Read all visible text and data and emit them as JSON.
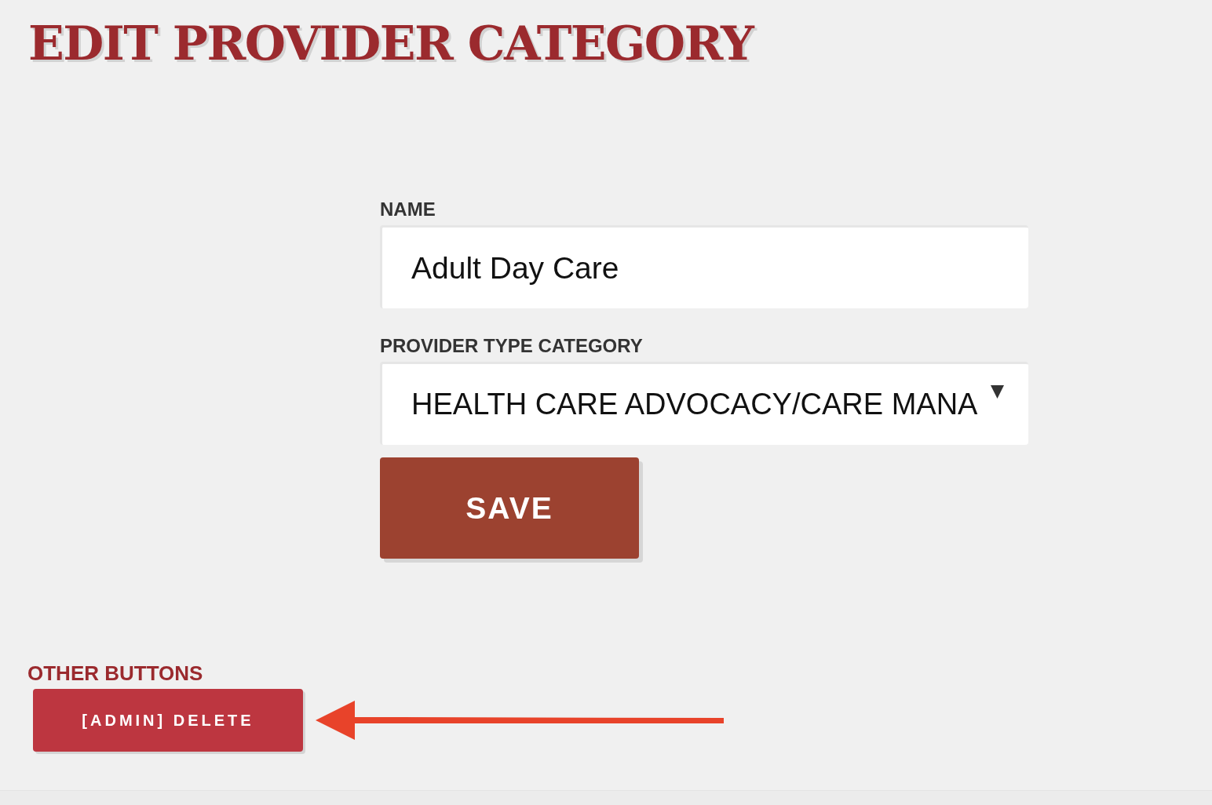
{
  "page": {
    "title": "EDIT PROVIDER CATEGORY"
  },
  "form": {
    "fields": [
      {
        "kind": "text",
        "label": "NAME",
        "value": "Adult Day Care"
      },
      {
        "kind": "select",
        "label": "PROVIDER TYPE CATEGORY",
        "value": "HEALTH CARE ADVOCACY/CARE MANA"
      }
    ],
    "submit": "SAVE"
  },
  "other_buttons": {
    "heading": "OTHER BUTTONS",
    "buttons": [
      "[ADMIN] DELETE"
    ]
  }
}
